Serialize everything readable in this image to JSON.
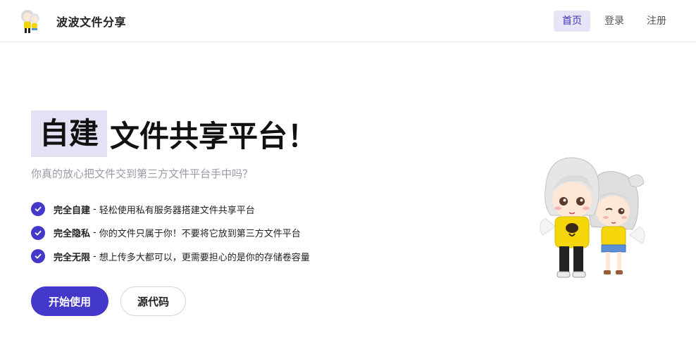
{
  "header": {
    "brand": "波波文件分享",
    "nav": [
      {
        "label": "首页",
        "active": true
      },
      {
        "label": "登录",
        "active": false
      },
      {
        "label": "注册",
        "active": false
      }
    ]
  },
  "hero": {
    "title_highlight": "自建",
    "title_rest": "文件共享平台！",
    "subtitle": "你真的放心把文件交到第三方文件平台手中吗？",
    "features": [
      {
        "title": "完全自建",
        "sep": "-",
        "desc": "轻松使用私有服务器搭建文件共享平台"
      },
      {
        "title": "完全隐私",
        "sep": "-",
        "desc": "你的文件只属于你！不要将它放到第三方文件平台"
      },
      {
        "title": "完全无限",
        "sep": "-",
        "desc": "想上传多大都可以，更需要担心的是你的存储卷容量"
      }
    ],
    "primary_button": "开始使用",
    "secondary_button": "源代码"
  },
  "colors": {
    "accent": "#4338ca",
    "nav_active_bg": "#e6e4f7",
    "highlight_bg": "#e3e1f3",
    "subtitle": "#9a9aa6"
  },
  "icons": {
    "logo": "chibi-couple-logo",
    "feature_check": "check-circle-icon",
    "illustration": "chibi-couple-illustration"
  }
}
